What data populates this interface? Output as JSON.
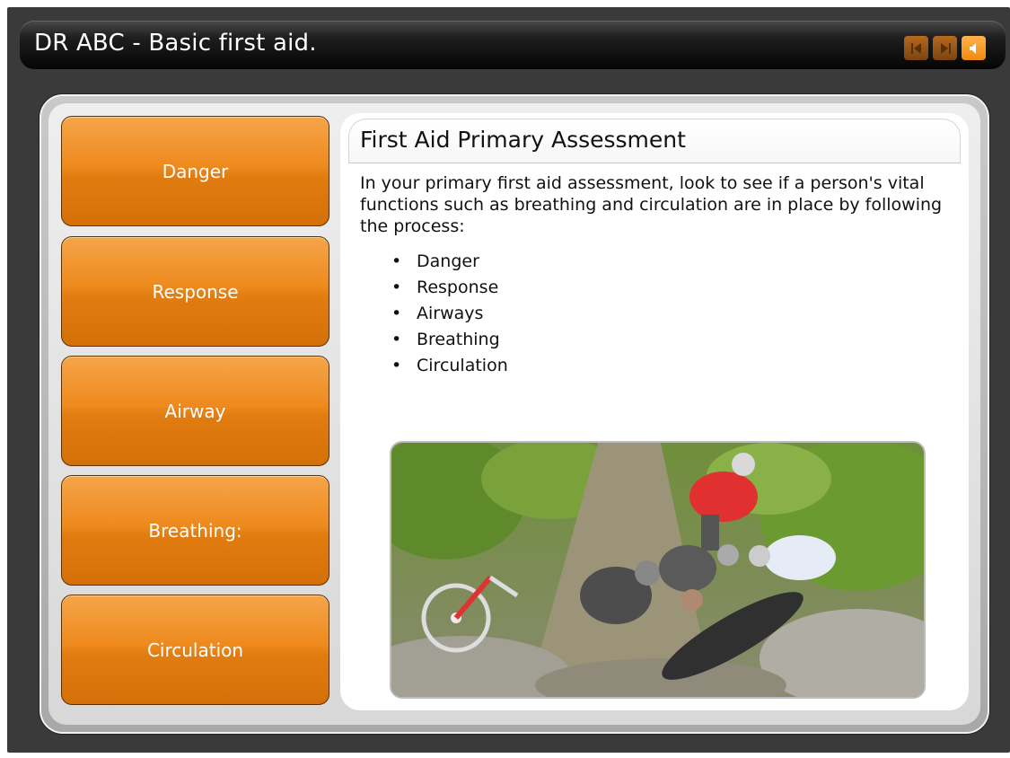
{
  "app": {
    "title": "DR ABC - Basic first aid."
  },
  "controls": {
    "prev_icon": "previous-icon",
    "next_icon": "next-icon",
    "sound_icon": "speaker-icon"
  },
  "menu": {
    "items": [
      {
        "label": "Danger"
      },
      {
        "label": "Response"
      },
      {
        "label": "Airway"
      },
      {
        "label": "Breathing:"
      },
      {
        "label": "Circulation"
      }
    ]
  },
  "content": {
    "heading": "First Aid Primary Assessment",
    "intro": "In your primary first aid assessment, look to see if a person's vital functions such as breathing and circulation are in place by following the process:",
    "bullets": [
      "Danger",
      "Response",
      "Airways",
      "Breathing",
      "Circulation"
    ]
  },
  "colors": {
    "accent": "#ee8a1e",
    "title_bar": "#050505",
    "background": "#3a3a3a"
  }
}
